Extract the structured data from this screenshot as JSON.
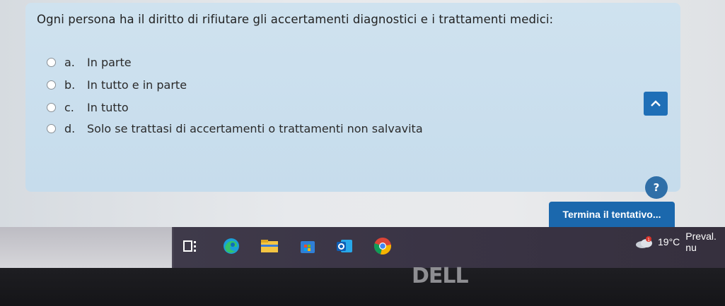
{
  "question": {
    "text": "Ogni persona ha il diritto di rifiutare gli accertamenti diagnostici e i trattamenti medici:",
    "options": [
      {
        "letter": "a.",
        "label": "In parte"
      },
      {
        "letter": "b.",
        "label": "In tutto e in parte"
      },
      {
        "letter": "c.",
        "label": "In tutto"
      },
      {
        "letter": "d.",
        "label": "Solo se trattasi di accertamenti o trattamenti non salvavita"
      }
    ]
  },
  "actions": {
    "help_label": "?",
    "finish_label": "Termina il tentativo..."
  },
  "taskbar": {
    "weather_temp": "19°C",
    "weather_text": "Preval. nu",
    "weather_badge": "1"
  },
  "bezel": {
    "brand": "DELL"
  },
  "colors": {
    "accent": "#1b68ad",
    "card": "#c9dded",
    "taskbar": "#3a3445"
  }
}
